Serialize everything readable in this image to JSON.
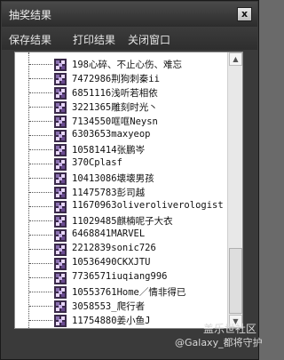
{
  "window": {
    "title": "抽奖结果",
    "close_glyph": "x"
  },
  "menu": {
    "items": [
      "保存结果",
      "打印结果",
      "关闭窗口"
    ]
  },
  "results": [
    "198心碎、不止心伤、难忘",
    "7472986荆狗刺秦ii",
    "6851116浅听若相依",
    "3221365雕刻时光丶",
    "7134550哐哐Neysn",
    "6303653maxyeop",
    "10581414张鹏岑",
    "370Cplasf",
    "10413086壊壊男孩",
    "11475783彭司越",
    "11670963oliveroliverologist",
    "11029485麒楠呢子大衣",
    "6468841MARVEL",
    "2212839sonic726",
    "10536490CKXJTU",
    "7736571iuqiang996",
    "10553761Home／情非得已",
    "3058553_爬行者",
    "11754880姜小鱼J"
  ],
  "watermark": {
    "line1": "盖乐世社区",
    "line2": "@Galaxy_都将守护"
  }
}
